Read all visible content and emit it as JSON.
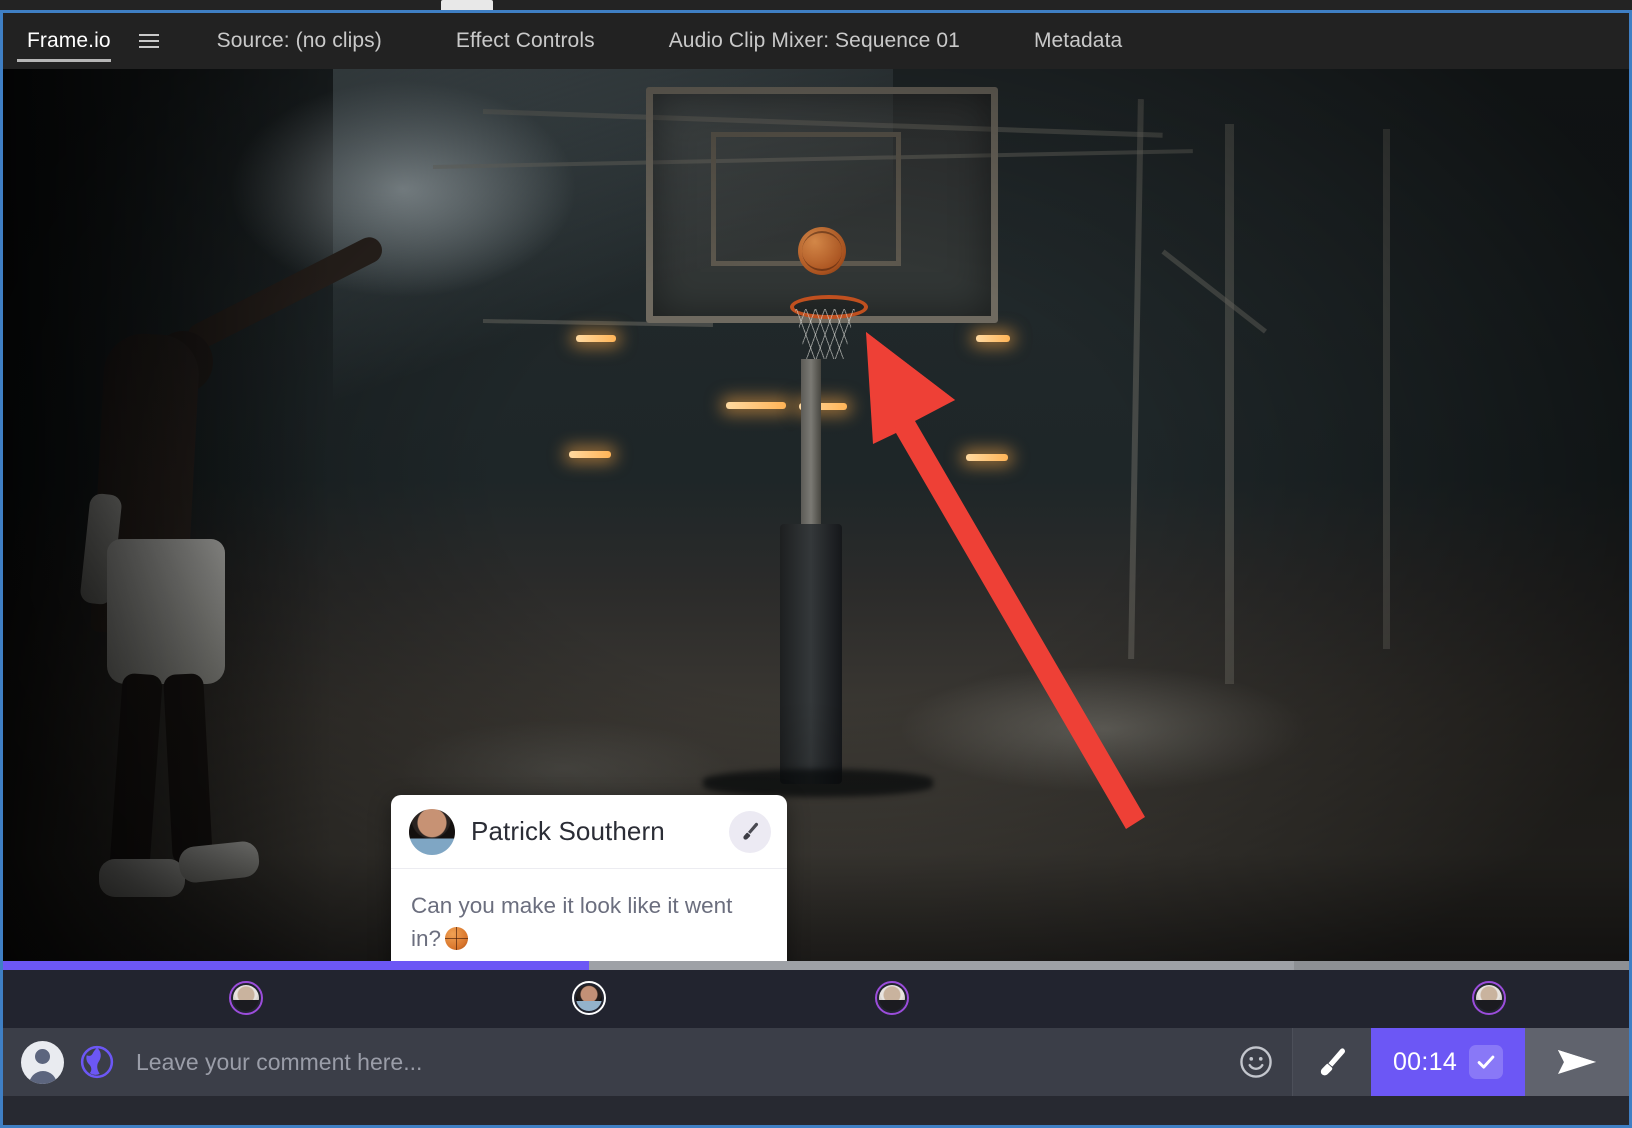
{
  "window": {
    "accent_purple": "#6c57f5",
    "focus_border": "#3f7fc4",
    "annotation_color": "#ee4036"
  },
  "tabbar": {
    "tabs": [
      {
        "label": "Frame.io",
        "active": true,
        "icon": "hamburger-menu-icon"
      },
      {
        "label": "Source: (no clips)",
        "active": false
      },
      {
        "label": "Effect Controls",
        "active": false
      },
      {
        "label": "Audio Clip Mixer: Sequence 01",
        "active": false
      },
      {
        "label": "Metadata",
        "active": false
      }
    ]
  },
  "viewer": {
    "annotation": {
      "type": "arrow",
      "color": "#ee4036",
      "points": "head at (866,266) tail at (1140,745)"
    },
    "scene": "basketball-court-warehouse"
  },
  "comment_popup": {
    "author": "Patrick Southern",
    "avatar": "user-avatar-patrick",
    "tool_icon": "paintbrush-icon",
    "text": "Can you make it look like it went",
    "text_line2": "in?",
    "emoji": "basketball-emoji"
  },
  "timeline": {
    "progress_percent": 36,
    "buffer_percent": 79,
    "markers": [
      {
        "x_percent": 14.7,
        "ring": "purple",
        "face": "a"
      },
      {
        "x_percent": 36.0,
        "ring": "white",
        "face": "b"
      },
      {
        "x_percent": 54.6,
        "ring": "purple",
        "face": "a"
      },
      {
        "x_percent": 91.4,
        "ring": "purple",
        "face": "a"
      }
    ]
  },
  "composer": {
    "avatar_icon": "default-user-avatar-icon",
    "globe_icon": "globe-icon",
    "placeholder": "Leave your comment here...",
    "value": "",
    "emoji_button_icon": "smiley-face-icon",
    "brush_button_icon": "paintbrush-icon",
    "timestamp": "00:14",
    "timestamp_check_icon": "checkmark-icon",
    "send_icon": "send-paper-plane-icon"
  }
}
